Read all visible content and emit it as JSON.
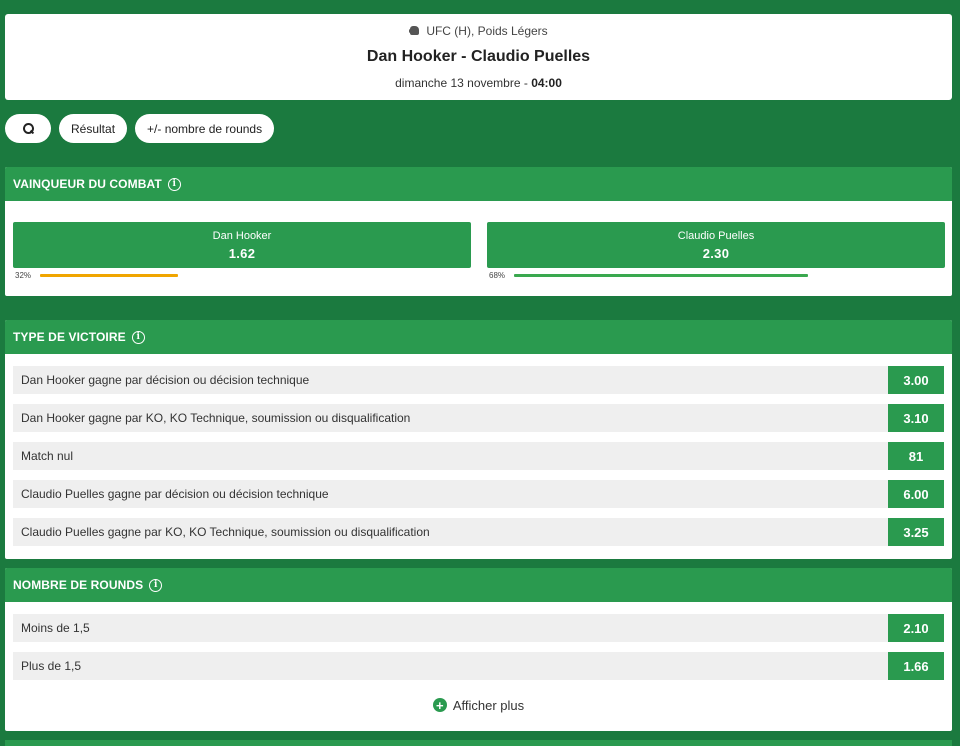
{
  "event": {
    "league": "UFC (H), Poids Légers",
    "title": "Dan Hooker - Claudio Puelles",
    "date_prefix": "dimanche 13 novembre - ",
    "time": "04:00"
  },
  "filters": {
    "search_icon": "search-icon",
    "items": [
      "Résultat",
      "+/- nombre de rounds"
    ]
  },
  "winner": {
    "title": "VAINQUEUR DU COMBAT",
    "fighters": [
      {
        "name": "Dan Hooker",
        "odd": "1.62",
        "pct_label": "32%",
        "pct": 32,
        "bar_color": "#f0a500"
      },
      {
        "name": "Claudio Puelles",
        "odd": "2.30",
        "pct_label": "68%",
        "pct": 68,
        "bar_color": "#3aa84f"
      }
    ]
  },
  "victory_type": {
    "title": "TYPE DE VICTOIRE",
    "rows": [
      {
        "label": "Dan Hooker gagne par décision ou décision technique",
        "odd": "3.00"
      },
      {
        "label": "Dan Hooker gagne par KO, KO Technique, soumission ou disqualification",
        "odd": "3.10"
      },
      {
        "label": "Match nul",
        "odd": "81"
      },
      {
        "label": "Claudio Puelles gagne par décision ou décision technique",
        "odd": "6.00"
      },
      {
        "label": "Claudio Puelles gagne par KO, KO Technique, soumission ou disqualification",
        "odd": "3.25"
      }
    ]
  },
  "rounds": {
    "title": "NOMBRE DE ROUNDS",
    "rows": [
      {
        "label": "Moins de 1,5",
        "odd": "2.10"
      },
      {
        "label": "Plus de 1,5",
        "odd": "1.66"
      }
    ],
    "more_label": "Afficher plus"
  },
  "colors": {
    "background": "#1b7a3f",
    "accent": "#2a9a4f",
    "row_bg": "#efefef"
  }
}
